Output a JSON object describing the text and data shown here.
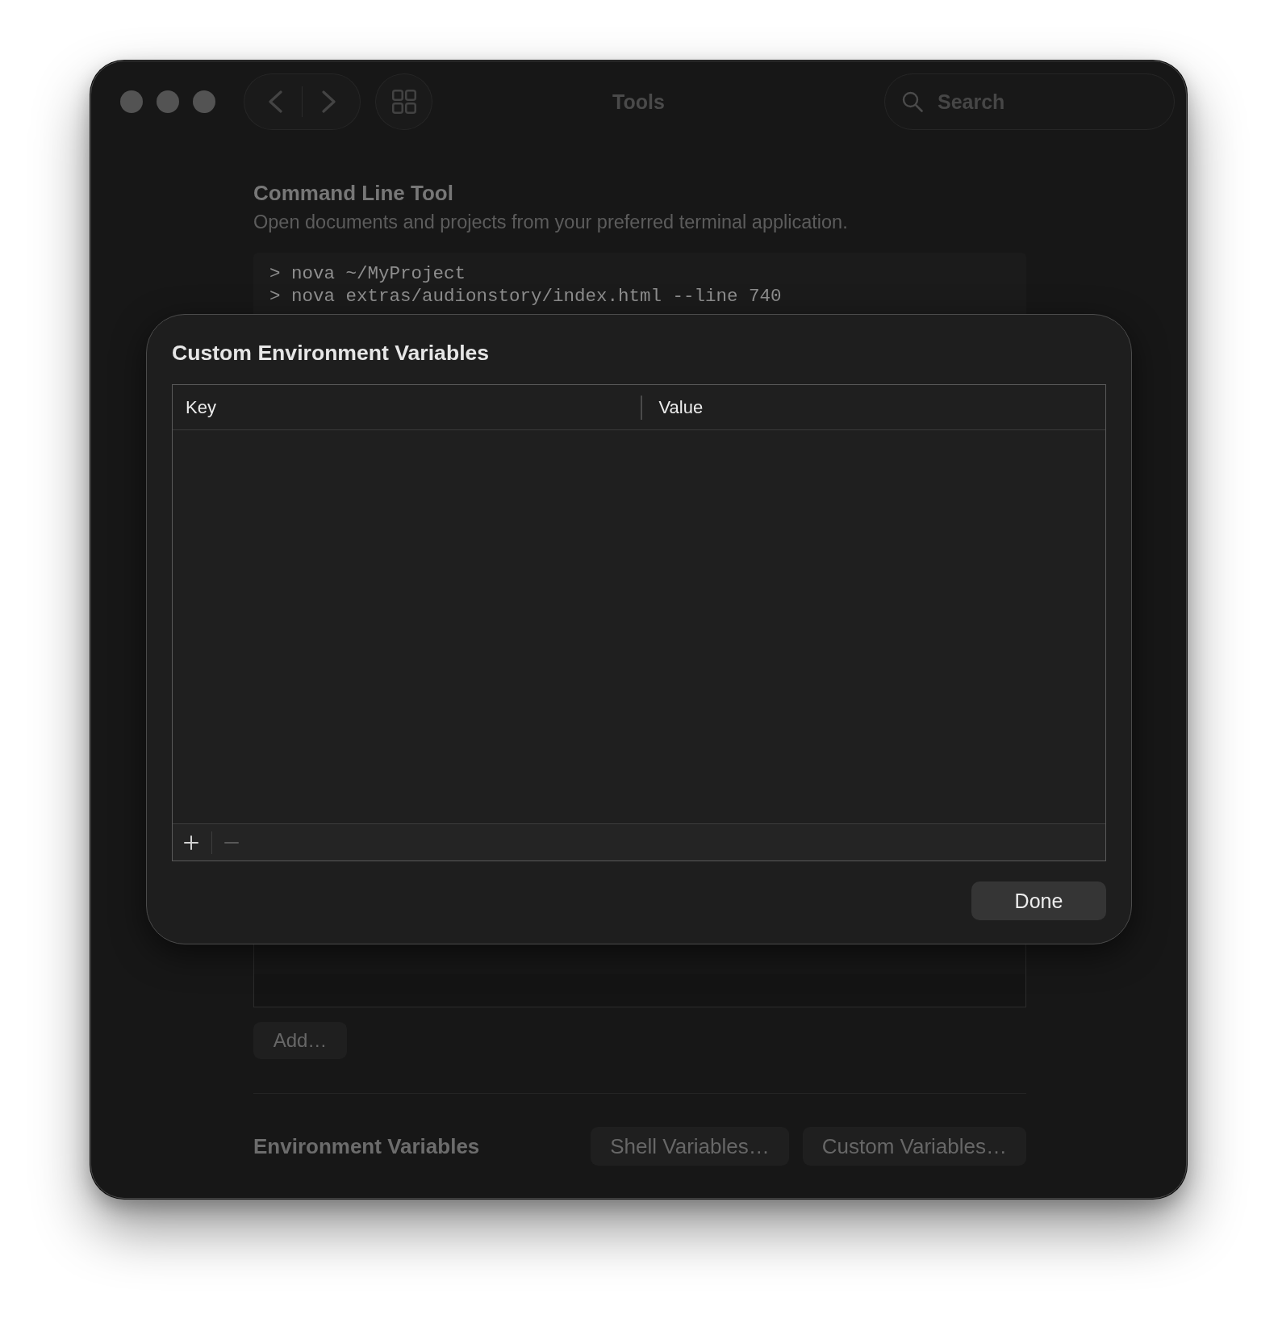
{
  "window": {
    "title": "Tools"
  },
  "toolbar": {
    "search": {
      "placeholder": "Search"
    }
  },
  "command_line_tool": {
    "title": "Command Line Tool",
    "description": "Open documents and projects from your preferred terminal application.",
    "code_lines": [
      "> nova ~/MyProject",
      "> nova extras/audionstory/index.html --line 740"
    ]
  },
  "list": {
    "add_button": "Add…"
  },
  "environment_variables": {
    "label": "Environment Variables",
    "buttons": [
      "Shell Variables…",
      "Custom Variables…"
    ]
  },
  "sheet": {
    "title": "Custom Environment Variables",
    "table": {
      "columns": [
        "Key",
        "Value"
      ],
      "footer_buttons": [
        {
          "kind": "add",
          "disabled": false
        },
        {
          "kind": "remove",
          "disabled": true
        }
      ]
    },
    "done_button": "Done"
  }
}
